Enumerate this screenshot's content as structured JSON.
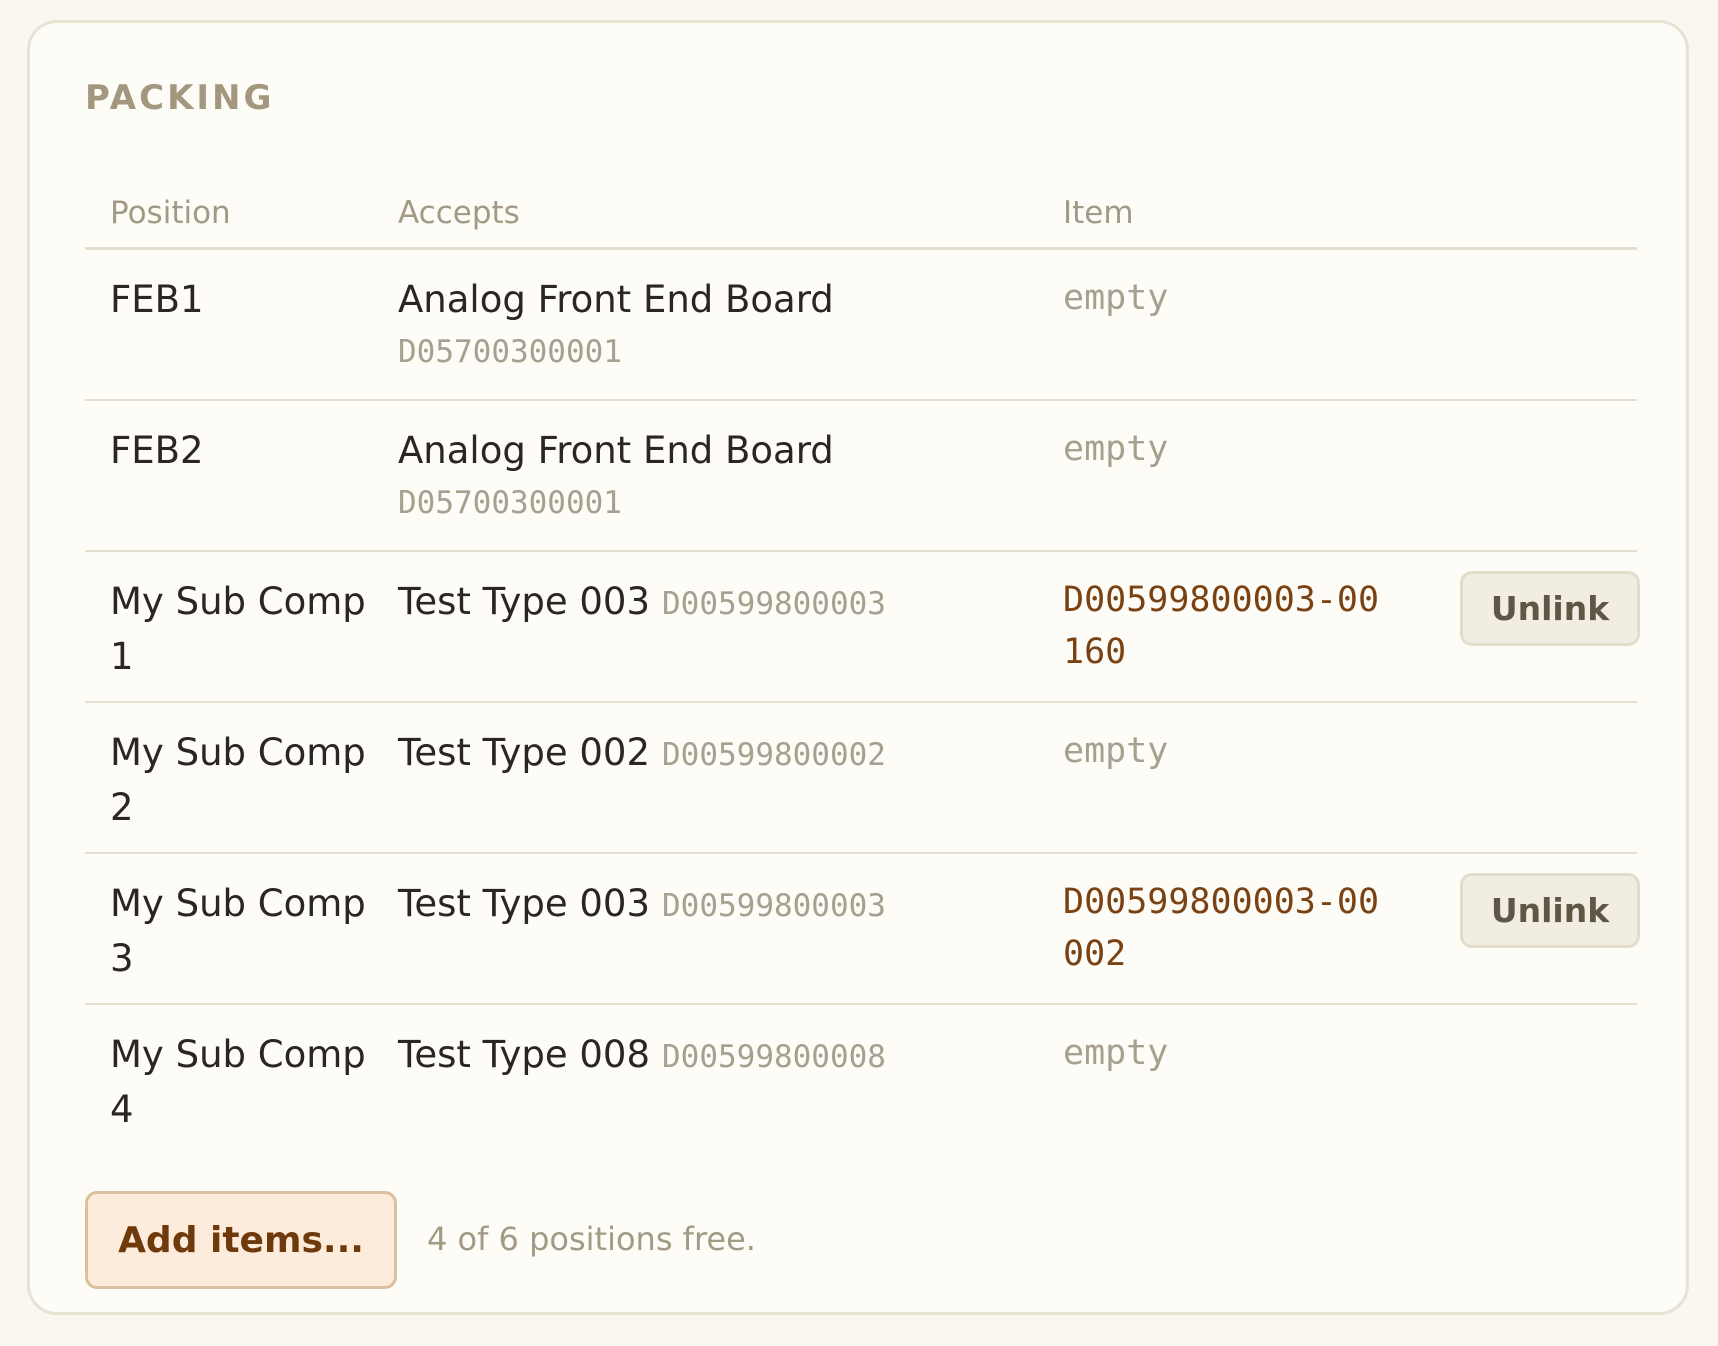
{
  "section": {
    "title": "PACKING"
  },
  "table": {
    "headers": {
      "position": "Position",
      "accepts": "Accepts",
      "item": "Item"
    },
    "rows": [
      {
        "position": "FEB1",
        "accepts_name": "Analog Front End Board",
        "accepts_code": "D05700300001",
        "item": "empty",
        "item_filled": false
      },
      {
        "position": "FEB2",
        "accepts_name": "Analog Front End Board",
        "accepts_code": "D05700300001",
        "item": "empty",
        "item_filled": false
      },
      {
        "position": "My Sub Comp 1",
        "accepts_name": "Test Type 003",
        "accepts_code": "D00599800003",
        "item": "D00599800003-00160",
        "item_filled": true,
        "action": "Unlink"
      },
      {
        "position": "My Sub Comp 2",
        "accepts_name": "Test Type 002",
        "accepts_code": "D00599800002",
        "item": "empty",
        "item_filled": false
      },
      {
        "position": "My Sub Comp 3",
        "accepts_name": "Test Type 003",
        "accepts_code": "D00599800003",
        "item": "D00599800003-00002",
        "item_filled": true,
        "action": "Unlink"
      },
      {
        "position": "My Sub Comp 4",
        "accepts_name": "Test Type 008",
        "accepts_code": "D00599800008",
        "item": "empty",
        "item_filled": false
      }
    ]
  },
  "footer": {
    "add_button_label": "Add items...",
    "free_text": "4 of 6 positions free."
  },
  "colors": {
    "background": "#faf7f0",
    "card": "#fdfcf7",
    "item_link": "#7a4212",
    "add_button_bg": "#fdecdb"
  }
}
